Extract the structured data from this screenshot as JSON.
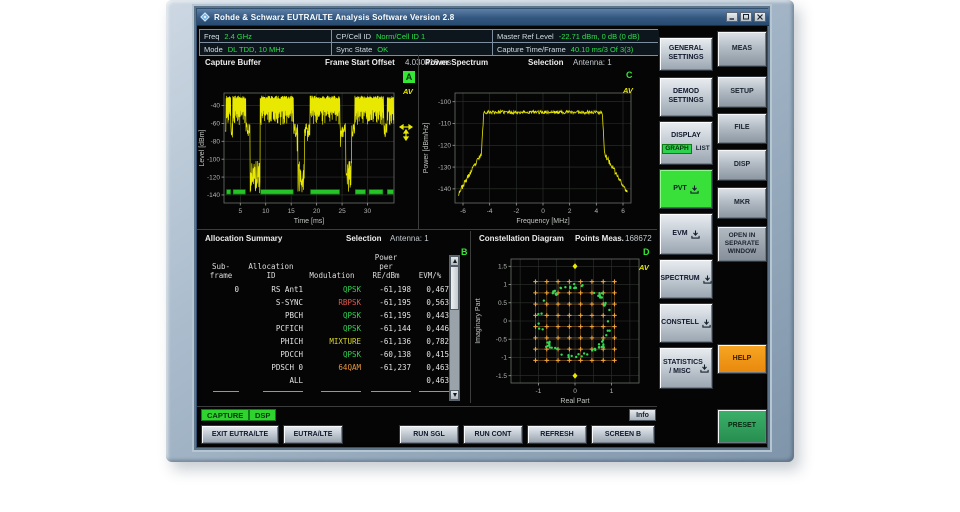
{
  "window": {
    "title": "Rohde & Schwarz EUTRA/LTE Analysis Software Version 2.8"
  },
  "info_bar": {
    "freq_label": "Freq",
    "freq_value": "2.4 GHz",
    "cp_label": "CP/Cell ID",
    "cp_value": "Norm/Cell ID 1",
    "mrl_label": "Master Ref Level",
    "mrl_value": "-22.71 dBm, 0 dB (0 dB)",
    "mode_label": "Mode",
    "mode_value": "DL TDD, 10 MHz",
    "sync_label": "Sync State",
    "sync_value": "OK",
    "ctf_label": "Capture Time/Frame",
    "ctf_value": "40.10 ms/3 Of 3(3)"
  },
  "panels": {
    "capture_buffer": {
      "title": "Capture Buffer",
      "offset_label": "Frame Start Offset",
      "offset_value": "4.030418 ms",
      "screen_badge": "A",
      "trace_label": "AV"
    },
    "power_spectrum": {
      "title": "Power Spectrum",
      "selection_label": "Selection",
      "selection_value": "Antenna: 1",
      "screen_letter": "C",
      "trace_label": "AV"
    },
    "allocation_summary": {
      "title": "Allocation Summary",
      "selection_label": "Selection",
      "selection_value": "Antenna: 1",
      "screen_letter": "B",
      "columns": [
        "Sub-\nframe",
        "Allocation\nID",
        "Modulation",
        "Power\nper\nRE/dBm",
        "EVM/%"
      ],
      "rows": [
        {
          "subframe": "0",
          "alloc": "RS Ant1",
          "mod": "QPSK",
          "mod_class": "qpsk",
          "power": "-61,198",
          "evm": "0,467"
        },
        {
          "subframe": "",
          "alloc": "S-SYNC",
          "mod": "RBPSK",
          "mod_class": "rbpsk",
          "power": "-61,195",
          "evm": "0,563"
        },
        {
          "subframe": "",
          "alloc": "PBCH",
          "mod": "QPSK",
          "mod_class": "qpsk",
          "power": "-61,195",
          "evm": "0,443"
        },
        {
          "subframe": "",
          "alloc": "PCFICH",
          "mod": "QPSK",
          "mod_class": "qpsk",
          "power": "-61,144",
          "evm": "0,446"
        },
        {
          "subframe": "",
          "alloc": "PHICH",
          "mod": "MIXTURE",
          "mod_class": "mixture",
          "power": "-61,136",
          "evm": "0,782"
        },
        {
          "subframe": "",
          "alloc": "PDCCH",
          "mod": "QPSK",
          "mod_class": "qpsk",
          "power": "-60,138",
          "evm": "0,415"
        },
        {
          "subframe": "",
          "alloc": "PDSCH 0",
          "mod": "64QAM",
          "mod_class": "qam64",
          "power": "-61,237",
          "evm": "0,463"
        },
        {
          "subframe": "",
          "alloc": "ALL",
          "mod": "",
          "mod_class": "none",
          "power": "",
          "evm": "0,463"
        }
      ]
    },
    "constellation": {
      "title": "Constellation Diagram",
      "points_label": "Points Meas.",
      "points_value": "168672",
      "screen_letter": "D",
      "trace_label": "AV"
    }
  },
  "keys": {
    "softkeys": [
      {
        "label": "GENERAL SETTINGS"
      },
      {
        "label": "DEMOD SETTINGS"
      },
      {
        "label": "DISPLAY",
        "graph": "GRAPH",
        "list": "LIST"
      },
      {
        "label": "PVT"
      },
      {
        "label": "EVM"
      },
      {
        "label": "SPECTRUM"
      },
      {
        "label": "CONSTELL"
      },
      {
        "label": "STATISTICS / MISC"
      }
    ],
    "hardkeys": [
      {
        "label": "MEAS"
      },
      {
        "label": "SETUP"
      },
      {
        "label": "FILE"
      },
      {
        "label": "DISP"
      },
      {
        "label": "MKR"
      },
      {
        "label": "OPEN IN SEPARATE WINDOW"
      },
      {
        "label": "HELP"
      },
      {
        "label": "PRESET"
      }
    ]
  },
  "status": {
    "capture": "CAPTURE",
    "dsp": "DSP",
    "info": "Info"
  },
  "toolbar": {
    "buttons": [
      {
        "label": "EXIT EUTRA/LTE"
      },
      {
        "label": "EUTRA/LTE"
      },
      {
        "label": "RUN SGL"
      },
      {
        "label": "RUN CONT"
      },
      {
        "label": "REFRESH"
      },
      {
        "label": "SCREEN B"
      }
    ]
  },
  "colors": {
    "trace_yellow": "#e8e800",
    "value_green": "#2be04a",
    "badge_green": "#35e635",
    "help_orange": "#f29111",
    "preset_green": "#2fa05a",
    "marker_green": "#27c427",
    "qam_ideal_orange": "#f0a43a",
    "meas_green": "#34d654"
  },
  "chart_data": [
    {
      "id": "capture_buffer",
      "type": "line",
      "title": "Capture Buffer",
      "xlabel": "Time [ms]",
      "ylabel": "Level [dBm]",
      "xlim": [
        1.8,
        35.2
      ],
      "ylim": [
        -149,
        -26
      ],
      "xticks": [
        5,
        10,
        15,
        20,
        25,
        30
      ],
      "yticks": [
        -40,
        -60,
        -80,
        -100,
        -120,
        -140
      ],
      "plot": [
        27,
        26,
        170,
        110
      ],
      "burst_level": -30,
      "noise_level": -68,
      "deep_level": -130,
      "bursts": [
        [
          2.2,
          3.1
        ],
        [
          3.5,
          6.1
        ],
        [
          8.9,
          15.5
        ],
        [
          18.7,
          24.6
        ],
        [
          27.5,
          33.2
        ],
        [
          33.8,
          35.2
        ]
      ],
      "deep_regions": [
        [
          6.9,
          8.9
        ],
        [
          16.3,
          17.6
        ],
        [
          25.7,
          26.9
        ]
      ],
      "marker_segments": [
        [
          2.3,
          3.1
        ],
        [
          3.6,
          6.0
        ],
        [
          9.0,
          15.4
        ],
        [
          18.8,
          24.5
        ],
        [
          27.6,
          29.6
        ],
        [
          30.3,
          33.0
        ],
        [
          33.9,
          35.1
        ]
      ]
    },
    {
      "id": "power_spectrum",
      "type": "line",
      "title": "Power Spectrum",
      "xlabel": "Frequency [MHz]",
      "ylabel": "Power [dBm/Hz]",
      "xlim": [
        -6.6,
        6.6
      ],
      "ylim": [
        -146.5,
        -96
      ],
      "xticks": [
        -6,
        -4,
        -2,
        0,
        2,
        4,
        6
      ],
      "yticks": [
        -100,
        -110,
        -120,
        -130,
        -140
      ],
      "plot": [
        34,
        26,
        176,
        110
      ],
      "flat_level": -104.8,
      "flat_range": [
        -4.45,
        4.45
      ],
      "edge_floor": -142
    },
    {
      "id": "constellation",
      "type": "scatter",
      "title": "Constellation Diagram",
      "xlabel": "Real Part",
      "ylabel": "Imaginary Part",
      "xlim": [
        -1.75,
        1.75
      ],
      "ylim": [
        -1.7,
        1.7
      ],
      "xticks": [
        -1,
        0,
        1
      ],
      "yticks": [
        -1.5,
        -1,
        -0.5,
        0,
        0.5,
        1,
        1.5
      ],
      "xgrid": [
        -1.5,
        -1,
        -0.5,
        0,
        0.5,
        1,
        1.5
      ],
      "ygrid": [
        -1.5,
        -1,
        -0.5,
        0,
        0.5,
        1,
        1.5
      ],
      "plot": [
        38,
        16,
        128,
        124
      ],
      "qam_levels": [
        -1.08,
        -0.772,
        -0.463,
        -0.154,
        0.154,
        0.463,
        0.772,
        1.08
      ],
      "sync_points": [
        [
          0,
          1.5
        ],
        [
          0,
          -1.5
        ]
      ],
      "ring_radius": 0.95
    }
  ]
}
